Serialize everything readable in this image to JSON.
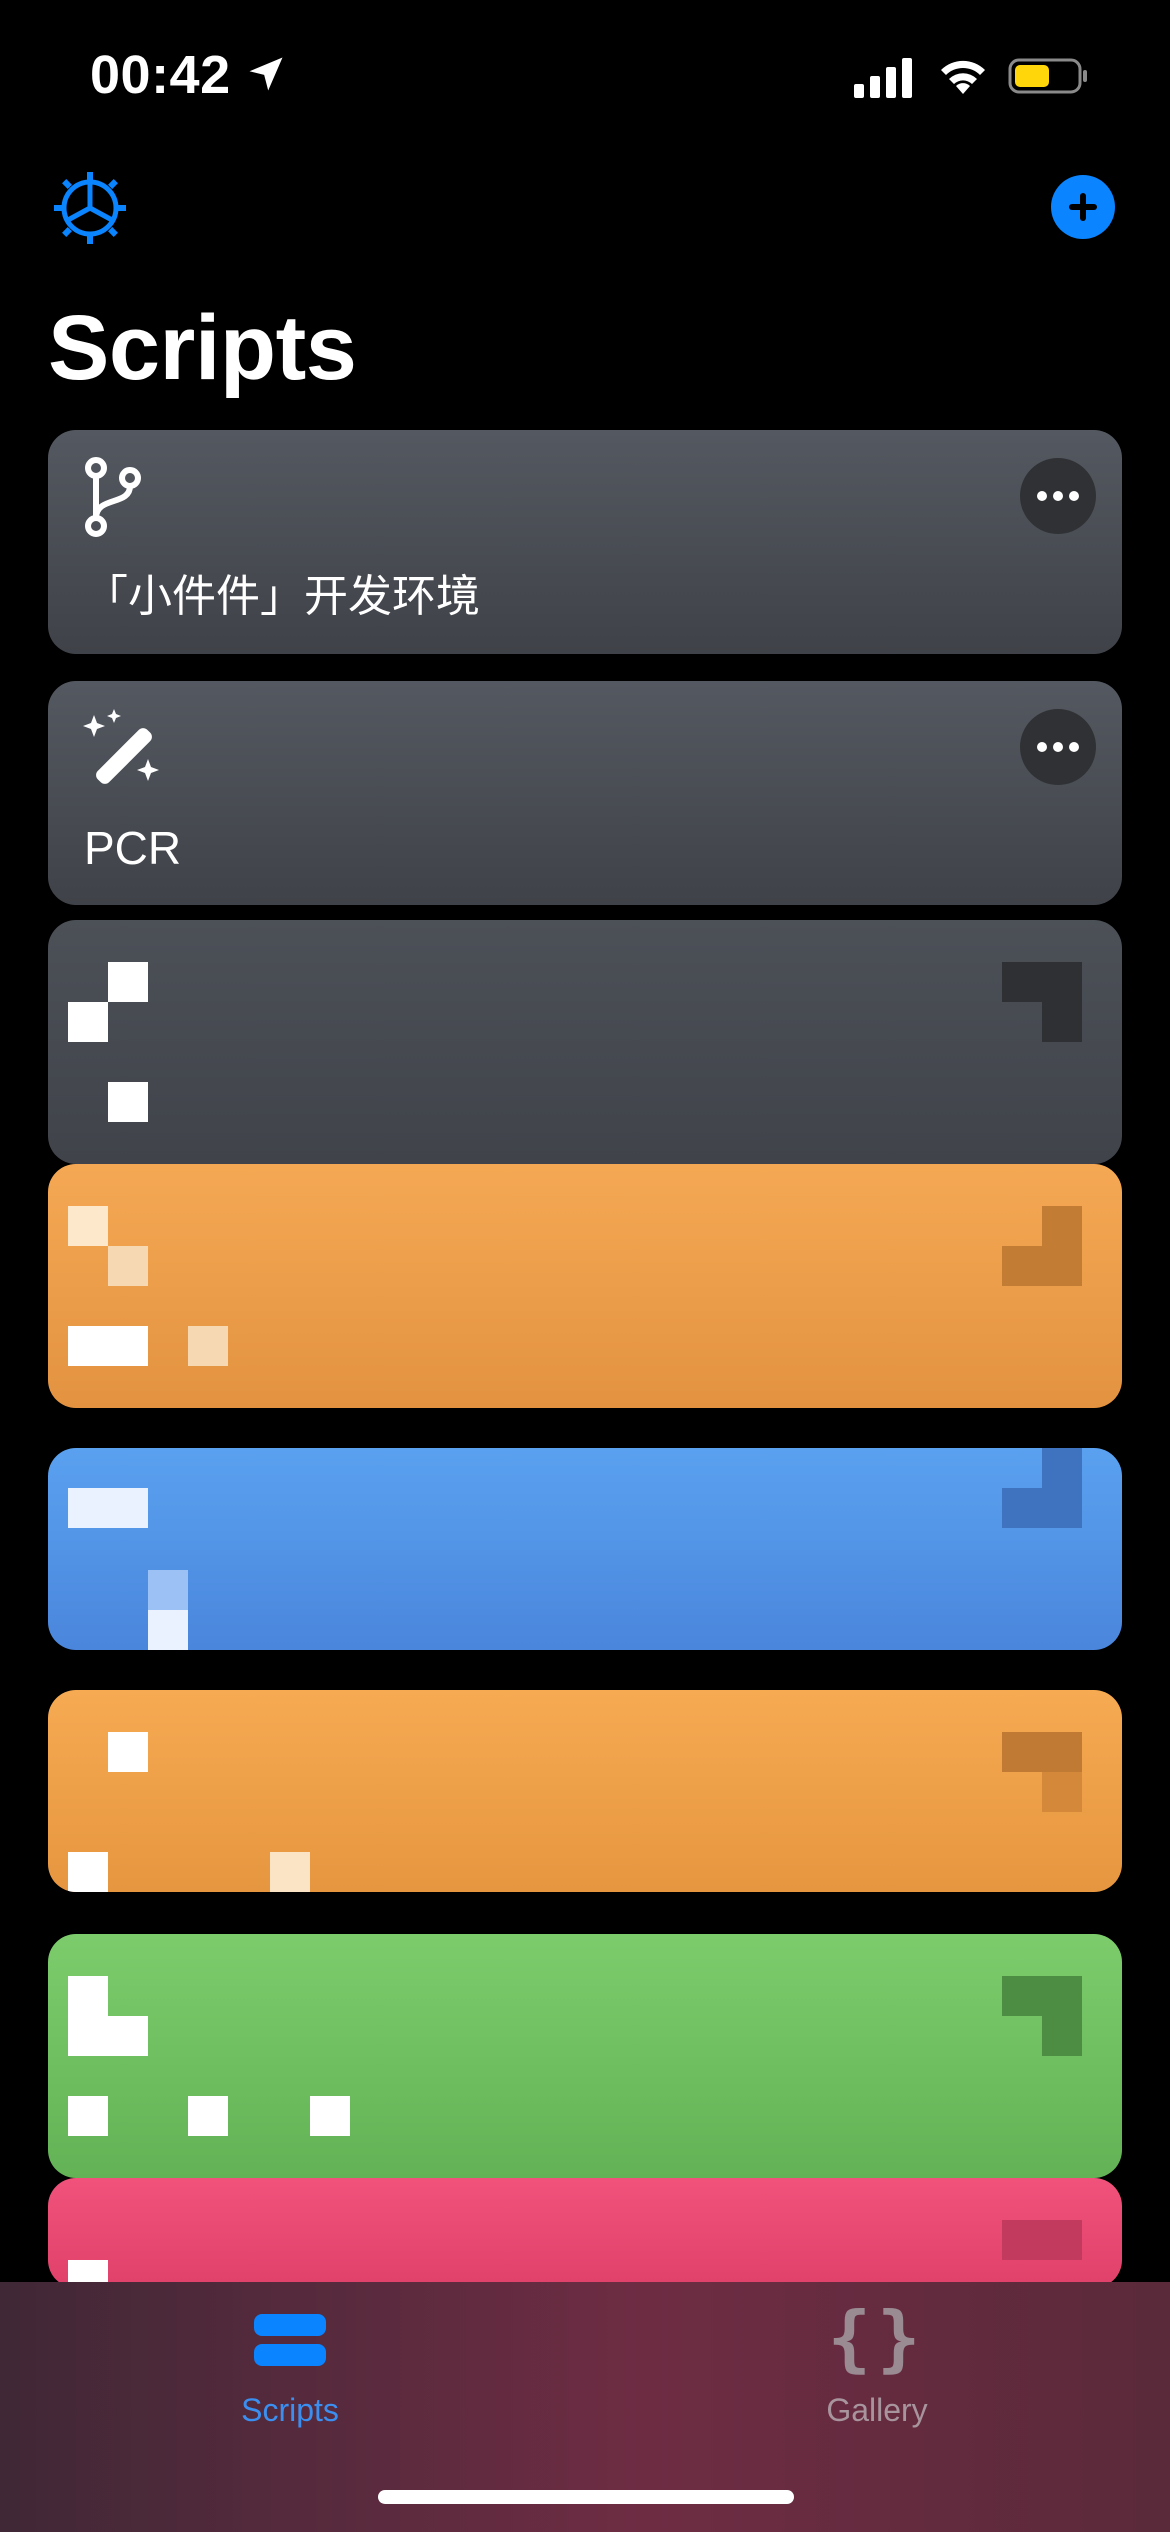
{
  "status_bar": {
    "time": "00:42"
  },
  "header": {
    "title": "Scripts"
  },
  "scripts": [
    {
      "label": "「小件件」开发环境",
      "icon": "git-branch-icon"
    },
    {
      "label": "PCR",
      "icon": "magic-wand-icon"
    }
  ],
  "tab_bar": {
    "tabs": [
      {
        "label": "Scripts",
        "icon": "stack-icon",
        "selected": true
      },
      {
        "label": "Gallery",
        "icon": "braces-icon",
        "selected": false
      }
    ]
  },
  "colors": {
    "accent": "#0a84ff",
    "card_grey": "#4a4d53",
    "orange": "#f0a24a",
    "blue": "#4f90e6",
    "green": "#6dc062",
    "pink": "#e6476f"
  }
}
